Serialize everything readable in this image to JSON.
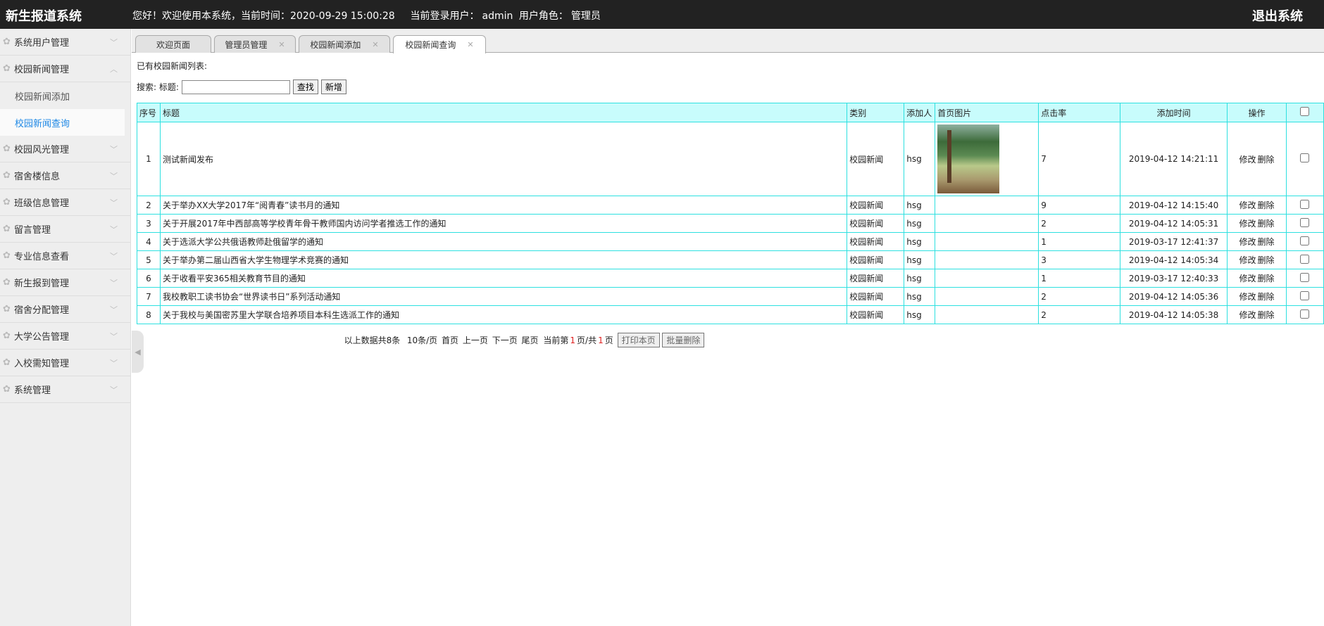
{
  "header": {
    "logo": "新生报道系统",
    "greeting": "您好！欢迎使用本系统，当前时间：2020-09-29 15:00:28",
    "user_label": "当前登录用户：",
    "user": "admin",
    "role_label": "用户角色：",
    "role": "管理员",
    "logout": "退出系统"
  },
  "sidebar": {
    "items": [
      {
        "label": "系统用户管理"
      },
      {
        "label": "校园新闻管理",
        "expanded": true,
        "children": [
          {
            "label": "校园新闻添加"
          },
          {
            "label": "校园新闻查询",
            "active": true
          }
        ]
      },
      {
        "label": "校园风光管理"
      },
      {
        "label": "宿舍楼信息"
      },
      {
        "label": "班级信息管理"
      },
      {
        "label": "留言管理"
      },
      {
        "label": "专业信息查看"
      },
      {
        "label": "新生报到管理"
      },
      {
        "label": "宿舍分配管理"
      },
      {
        "label": "大学公告管理"
      },
      {
        "label": "入校需知管理"
      },
      {
        "label": "系统管理"
      }
    ]
  },
  "tabs": [
    {
      "label": "欢迎页面"
    },
    {
      "label": "管理员管理"
    },
    {
      "label": "校园新闻添加"
    },
    {
      "label": "校园新闻查询",
      "active": true
    }
  ],
  "main": {
    "list_title": "已有校园新闻列表:",
    "search_label": "搜索: 标题:",
    "search_value": "",
    "search_button": "查找",
    "add_button": "新增",
    "columns": [
      "序号",
      "标题",
      "类别",
      "添加人",
      "首页图片",
      "点击率",
      "添加时间",
      "操作"
    ],
    "edit": "修改",
    "delete": "删除",
    "rows": [
      {
        "no": "1",
        "title": "测试新闻发布",
        "category": "校园新闻",
        "author": "hsg",
        "has_image": true,
        "clicks": "7",
        "time": "2019-04-12 14:21:11"
      },
      {
        "no": "2",
        "title": "关于举办XX大学2017年“阅青春”读书月的通知",
        "category": "校园新闻",
        "author": "hsg",
        "clicks": "9",
        "time": "2019-04-12 14:15:40"
      },
      {
        "no": "3",
        "title": "关于开展2017年中西部高等学校青年骨干教师国内访问学者推选工作的通知",
        "category": "校园新闻",
        "author": "hsg",
        "clicks": "2",
        "time": "2019-04-12 14:05:31"
      },
      {
        "no": "4",
        "title": "关于选派大学公共俄语教师赴俄留学的通知",
        "category": "校园新闻",
        "author": "hsg",
        "clicks": "1",
        "time": "2019-03-17 12:41:37"
      },
      {
        "no": "5",
        "title": "关于举办第二届山西省大学生物理学术竞赛的通知",
        "category": "校园新闻",
        "author": "hsg",
        "clicks": "3",
        "time": "2019-04-12 14:05:34"
      },
      {
        "no": "6",
        "title": "关于收看平安365相关教育节目的通知",
        "category": "校园新闻",
        "author": "hsg",
        "clicks": "1",
        "time": "2019-03-17 12:40:33"
      },
      {
        "no": "7",
        "title": "我校教职工读书协会“世界读书日”系列活动通知",
        "category": "校园新闻",
        "author": "hsg",
        "clicks": "2",
        "time": "2019-04-12 14:05:36"
      },
      {
        "no": "8",
        "title": "关于我校与美国密苏里大学联合培养项目本科生选派工作的通知",
        "category": "校园新闻",
        "author": "hsg",
        "clicks": "2",
        "time": "2019-04-12 14:05:38"
      }
    ]
  },
  "pager": {
    "total": "以上数据共8条",
    "per_page": "10条/页",
    "first": "首页",
    "prev": "上一页",
    "next": "下一页",
    "last": "尾页",
    "current_prefix": "当前第",
    "current": "1",
    "mid": "页/共",
    "pages": "1",
    "suffix": "页",
    "print": "打印本页",
    "batch_delete": "批量删除"
  }
}
